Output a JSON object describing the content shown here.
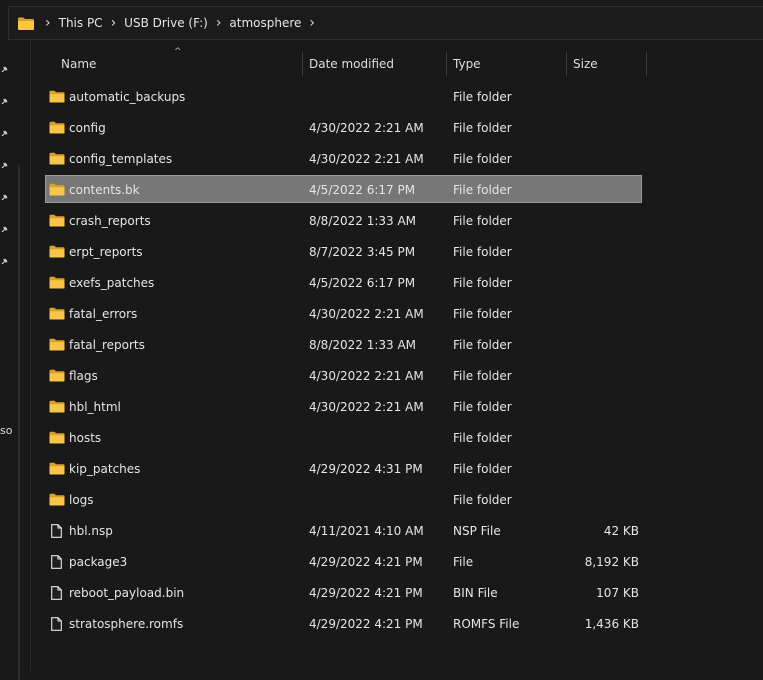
{
  "breadcrumb": {
    "segments": [
      "This PC",
      "USB Drive (F:)",
      "atmosphere"
    ]
  },
  "left_rail": {
    "partial_label": "so"
  },
  "columns": {
    "name": "Name",
    "date": "Date modified",
    "type": "Type",
    "size": "Size"
  },
  "rows": [
    {
      "icon": "folder-icon",
      "name": "automatic_backups",
      "date": "",
      "type": "File folder",
      "size": ""
    },
    {
      "icon": "folder-icon",
      "name": "config",
      "date": "4/30/2022 2:21 AM",
      "type": "File folder",
      "size": ""
    },
    {
      "icon": "folder-icon",
      "name": "config_templates",
      "date": "4/30/2022 2:21 AM",
      "type": "File folder",
      "size": ""
    },
    {
      "icon": "folder-icon",
      "name": "contents.bk",
      "date": "4/5/2022 6:17 PM",
      "type": "File folder",
      "size": "",
      "selected": true
    },
    {
      "icon": "folder-icon",
      "name": "crash_reports",
      "date": "8/8/2022 1:33 AM",
      "type": "File folder",
      "size": ""
    },
    {
      "icon": "folder-icon",
      "name": "erpt_reports",
      "date": "8/7/2022 3:45 PM",
      "type": "File folder",
      "size": ""
    },
    {
      "icon": "folder-icon",
      "name": "exefs_patches",
      "date": "4/5/2022 6:17 PM",
      "type": "File folder",
      "size": ""
    },
    {
      "icon": "folder-icon",
      "name": "fatal_errors",
      "date": "4/30/2022 2:21 AM",
      "type": "File folder",
      "size": ""
    },
    {
      "icon": "folder-icon",
      "name": "fatal_reports",
      "date": "8/8/2022 1:33 AM",
      "type": "File folder",
      "size": ""
    },
    {
      "icon": "folder-icon",
      "name": "flags",
      "date": "4/30/2022 2:21 AM",
      "type": "File folder",
      "size": ""
    },
    {
      "icon": "folder-icon",
      "name": "hbl_html",
      "date": "4/30/2022 2:21 AM",
      "type": "File folder",
      "size": ""
    },
    {
      "icon": "folder-icon",
      "name": "hosts",
      "date": "",
      "type": "File folder",
      "size": ""
    },
    {
      "icon": "folder-icon",
      "name": "kip_patches",
      "date": "4/29/2022 4:31 PM",
      "type": "File folder",
      "size": ""
    },
    {
      "icon": "folder-icon",
      "name": "logs",
      "date": "",
      "type": "File folder",
      "size": ""
    },
    {
      "icon": "file-icon",
      "name": "hbl.nsp",
      "date": "4/11/2021 4:10 AM",
      "type": "NSP File",
      "size": "42 KB"
    },
    {
      "icon": "file-icon",
      "name": "package3",
      "date": "4/29/2022 4:21 PM",
      "type": "File",
      "size": "8,192 KB"
    },
    {
      "icon": "file-icon",
      "name": "reboot_payload.bin",
      "date": "4/29/2022 4:21 PM",
      "type": "BIN File",
      "size": "107 KB"
    },
    {
      "icon": "file-icon",
      "name": "stratosphere.romfs",
      "date": "4/29/2022 4:21 PM",
      "type": "ROMFS File",
      "size": "1,436 KB"
    }
  ],
  "colors": {
    "background": "#191919",
    "folder": "#f8c548",
    "folder_dark": "#d9a12a",
    "selection": "#777777"
  }
}
